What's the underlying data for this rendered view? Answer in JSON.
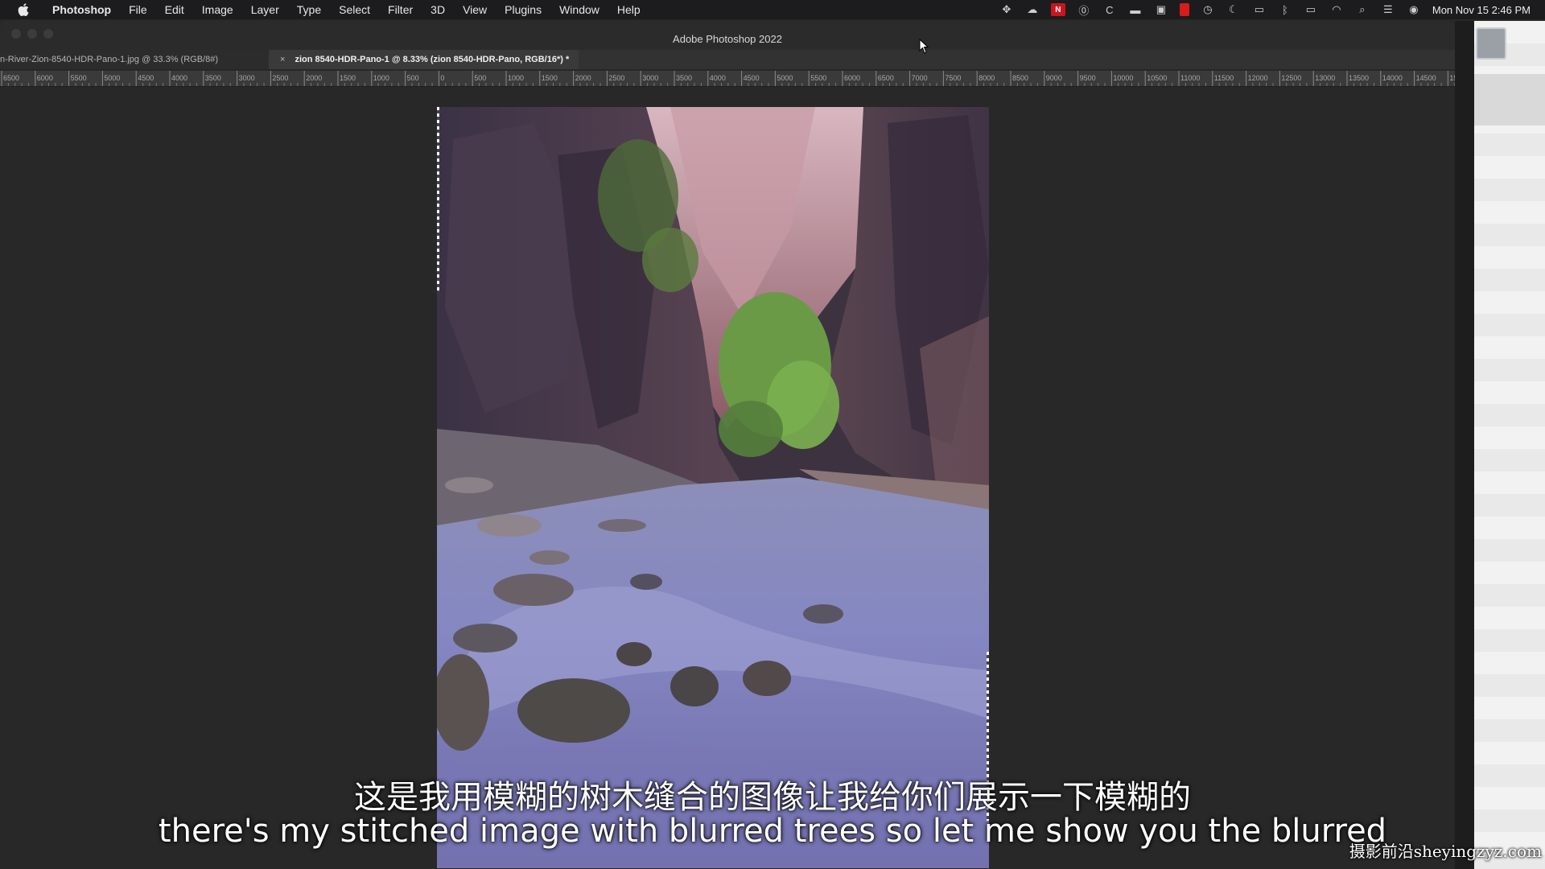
{
  "menubar": {
    "app_name": "Photoshop",
    "items": [
      "File",
      "Edit",
      "Image",
      "Layer",
      "Type",
      "Select",
      "Filter",
      "3D",
      "View",
      "Plugins",
      "Window",
      "Help"
    ],
    "clock": "Mon Nov 15  2:46 PM"
  },
  "window": {
    "title": "Adobe Photoshop 2022"
  },
  "tabs": [
    {
      "label": "n-River-Zion-8540-HDR-Pano-1.jpg @ 33.3% (RGB/8#)",
      "active": false
    },
    {
      "close": "×",
      "label": "zion 8540-HDR-Pano-1 @ 8.33% (zion 8540-HDR-Pano, RGB/16*) *",
      "active": true
    }
  ],
  "ruler": {
    "labels": [
      "6500",
      "6000",
      "5500",
      "5000",
      "4500",
      "4000",
      "3500",
      "3000",
      "2500",
      "2000",
      "1500",
      "1000",
      "500",
      "0",
      "500",
      "1000",
      "1500",
      "2000",
      "2500",
      "3000",
      "3500",
      "4000",
      "4500",
      "5000",
      "5500",
      "6000",
      "6500",
      "7000",
      "7500",
      "8000",
      "8500",
      "9000",
      "9500",
      "10000",
      "10500",
      "11000",
      "11500",
      "12000",
      "12500",
      "13000",
      "13500",
      "14000",
      "14500",
      "15"
    ]
  },
  "subtitles": {
    "chinese": "这是我用模糊的树木缝合的图像让我给你们展示一下模糊的",
    "english": "there's my stitched image with blurred trees so let me show you the blurred"
  },
  "watermark": "摄影前沿sheyingzyz.com",
  "colors": {
    "menubar_bg": "#1c1c1e",
    "workspace_bg": "#282828",
    "tab_active_bg": "#3a3a3a"
  }
}
